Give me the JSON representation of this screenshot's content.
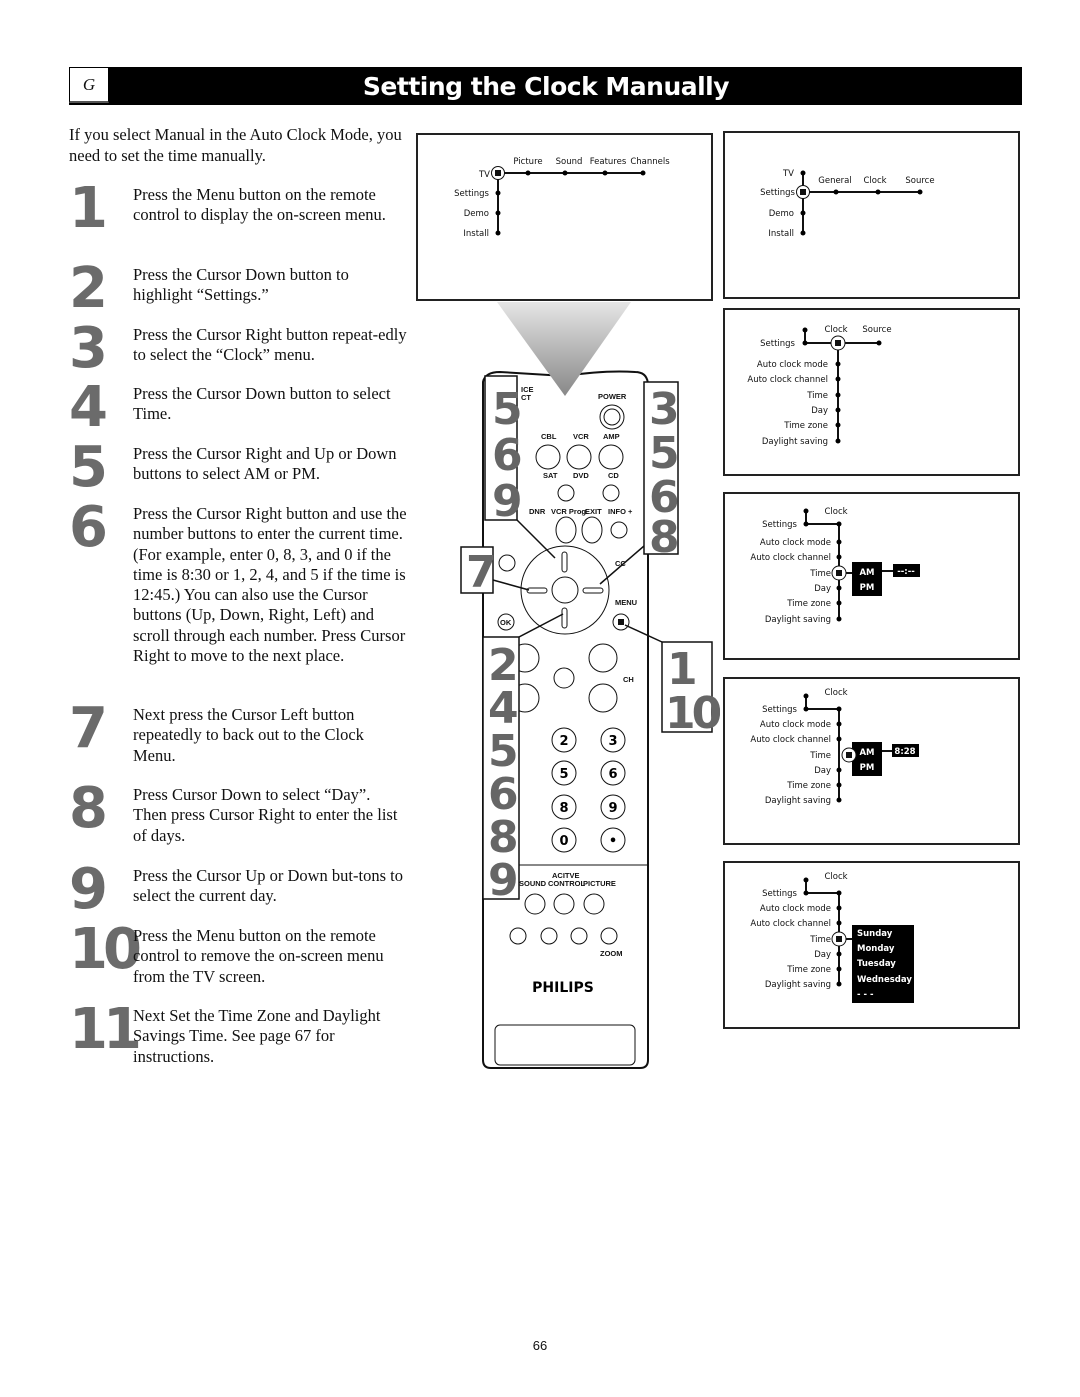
{
  "header": {
    "section_letter": "G",
    "title": "Setting the Clock Manually"
  },
  "intro": "If you select Manual in the Auto Clock Mode, you need to set the time manually.",
  "steps": [
    {
      "num": "1",
      "text": "Press the Menu button on the remote control to display the on-screen menu."
    },
    {
      "num": "2",
      "text": "Press the Cursor Down button to highlight “Settings.”"
    },
    {
      "num": "3",
      "text": "Press the Cursor Right button repeat-edly to select the “Clock” menu."
    },
    {
      "num": "4",
      "text": "Press the Cursor Down button to select Time."
    },
    {
      "num": "5",
      "text": "Press the Cursor Right and Up or Down buttons to select AM or PM."
    },
    {
      "num": "6",
      "text": "Press the Cursor Right button and use the number buttons to enter the current time.  (For example, enter 0, 8, 3, and 0 if the time is 8:30 or 1, 2, 4, and 5 if the time is 12:45.)  You can also use the Cursor buttons (Up, Down, Right, Left) and scroll through each number.  Press Cursor Right to move to the next place."
    },
    {
      "num": "7",
      "text": "Next press the Cursor Left button repeatedly to back out to the Clock Menu."
    },
    {
      "num": "8",
      "text": "Press Cursor Down to select “Day”. Then press Cursor Right to enter the list of days."
    },
    {
      "num": "9",
      "text": "Press the Cursor Up or Down but-tons to select the current day."
    },
    {
      "num": "10",
      "text": "Press the Menu button on the remote control to remove the on-screen menu from the TV screen."
    },
    {
      "num": "11",
      "text": "Next Set the Time Zone and Daylight Savings Time.  See page 67 for instructions."
    }
  ],
  "screens": {
    "main_menu": {
      "root": "TV",
      "top_items": [
        "Picture",
        "Sound",
        "Features",
        "Channels"
      ],
      "side_items": [
        "Settings",
        "Demo",
        "Install"
      ]
    },
    "settings_menu": {
      "side_items": [
        "TV",
        "Settings",
        "Demo",
        "Install"
      ],
      "top_items": [
        "General",
        "Clock",
        "Source"
      ]
    },
    "clock_menu": {
      "parent": "Settings",
      "top_items": [
        "Clock",
        "Source"
      ],
      "items": [
        "Auto clock mode",
        "Auto clock channel",
        "Time",
        "Day",
        "Time zone",
        "Daylight saving"
      ]
    },
    "ampm_menu": {
      "parent": "Settings",
      "title": "Clock",
      "items": [
        "Auto clock mode",
        "Auto clock channel",
        "Time",
        "Day",
        "Time zone",
        "Daylight saving"
      ],
      "options": [
        "AM",
        "PM"
      ],
      "time_value": "--:--"
    },
    "time_menu": {
      "parent": "Settings",
      "title": "Clock",
      "items": [
        "Auto clock mode",
        "Auto clock channel",
        "Time",
        "Day",
        "Time zone",
        "Daylight saving"
      ],
      "options": [
        "AM",
        "PM"
      ],
      "time_value": "8:28"
    },
    "day_menu": {
      "parent": "Settings",
      "title": "Clock",
      "items": [
        "Auto clock mode",
        "Auto clock channel",
        "Time",
        "Day",
        "Time zone",
        "Daylight saving"
      ],
      "days": [
        "Sunday",
        "Monday",
        "Tuesday",
        "Wednesday",
        "- - -"
      ]
    }
  },
  "remote": {
    "brand": "PHILIPS",
    "labels": {
      "source": "ICE\nCT",
      "power": "POWER",
      "cbl": "CBL",
      "vcr": "VCR",
      "amp": "AMP",
      "sat": "SAT",
      "dvd": "DVD",
      "cd": "CD",
      "dnr": "DNR",
      "vcr_prog": "VCR Prog.",
      "exit": "EXIT",
      "info": "INFO +",
      "cc": "CC",
      "menu": "MENU",
      "ok": "OK",
      "ch": "CH",
      "active_control_top": "ACITVE",
      "sound": "SOUND",
      "control": "CONTROL",
      "picture": "PICTURE",
      "zoom": "ZOOM"
    },
    "keypad": [
      "2",
      "3",
      "5",
      "6",
      "8",
      "9",
      "0",
      "•"
    ],
    "callouts": {
      "left_top": [
        "5",
        "6",
        "9"
      ],
      "right_top": [
        "3",
        "5",
        "6",
        "8"
      ],
      "left_mid": [
        "7"
      ],
      "left_bottom": [
        "2",
        "4",
        "5",
        "6",
        "8",
        "9"
      ],
      "right_bottom": [
        "1",
        "10"
      ]
    }
  },
  "page_number": "66"
}
